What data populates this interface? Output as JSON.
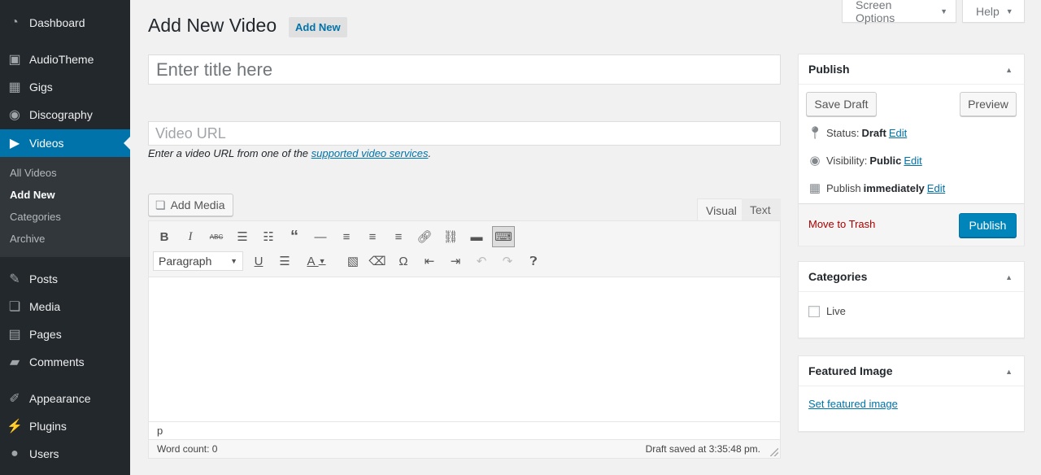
{
  "sidebar": {
    "items": [
      {
        "label": "Dashboard",
        "icon": "dashboard-icon"
      },
      {
        "label": "AudioTheme",
        "icon": "audiotheme-icon"
      },
      {
        "label": "Gigs",
        "icon": "calendar-icon"
      },
      {
        "label": "Discography",
        "icon": "disc-icon"
      },
      {
        "label": "Videos",
        "icon": "video-icon"
      },
      {
        "label": "Posts",
        "icon": "pin-icon"
      },
      {
        "label": "Media",
        "icon": "media-icon"
      },
      {
        "label": "Pages",
        "icon": "pages-icon"
      },
      {
        "label": "Comments",
        "icon": "comments-icon"
      },
      {
        "label": "Appearance",
        "icon": "brush-icon"
      },
      {
        "label": "Plugins",
        "icon": "plugin-icon"
      },
      {
        "label": "Users",
        "icon": "user-icon"
      }
    ],
    "submenu": [
      "All Videos",
      "Add New",
      "Categories",
      "Archive"
    ]
  },
  "top": {
    "screen_options": "Screen Options",
    "help": "Help"
  },
  "header": {
    "title": "Add New Video",
    "add_new": "Add New"
  },
  "title_field": {
    "placeholder": "Enter title here"
  },
  "video_url": {
    "placeholder": "Video URL",
    "help_prefix": "Enter a video URL from one of the ",
    "help_link": "supported video services",
    "help_suffix": "."
  },
  "editor": {
    "add_media": "Add Media",
    "tab_visual": "Visual",
    "tab_text": "Text",
    "format": "Paragraph",
    "path": "p",
    "word_count": "Word count: 0",
    "saved": "Draft saved at 3:35:48 pm."
  },
  "publish": {
    "title": "Publish",
    "save_draft": "Save Draft",
    "preview": "Preview",
    "status_label": "Status:",
    "status_value": "Draft",
    "visibility_label": "Visibility:",
    "visibility_value": "Public",
    "publish_prefix": "Publish",
    "publish_value": "immediately",
    "edit": "Edit",
    "trash": "Move to Trash",
    "publish_btn": "Publish"
  },
  "categories": {
    "title": "Categories",
    "items": [
      "Live"
    ]
  },
  "featured_image": {
    "title": "Featured Image",
    "link": "Set featured image"
  },
  "colors": {
    "sidebar": "#23282d",
    "accent": "#0073aa",
    "publish": "#0085ba",
    "trash": "#a00"
  }
}
